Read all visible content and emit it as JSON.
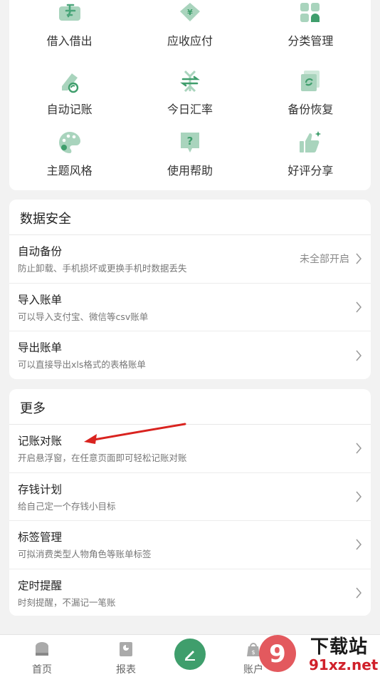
{
  "grid": {
    "items": [
      {
        "label": "借入借出",
        "icon": "lend-borrow-icon"
      },
      {
        "label": "应收应付",
        "icon": "receivable-payable-icon"
      },
      {
        "label": "分类管理",
        "icon": "category-manage-icon"
      },
      {
        "label": "自动记账",
        "icon": "auto-bookkeeping-icon"
      },
      {
        "label": "今日汇率",
        "icon": "exchange-rate-icon"
      },
      {
        "label": "备份恢复",
        "icon": "backup-restore-icon"
      },
      {
        "label": "主题风格",
        "icon": "palette-icon"
      },
      {
        "label": "使用帮助",
        "icon": "help-icon"
      },
      {
        "label": "好评分享",
        "icon": "thumbs-up-icon"
      }
    ]
  },
  "security": {
    "title": "数据安全",
    "rows": [
      {
        "title": "自动备份",
        "subtitle": "防止卸载、手机损坏或更换手机时数据丢失",
        "status": "未全部开启"
      },
      {
        "title": "导入账单",
        "subtitle": "可以导入支付宝、微信等csv账单"
      },
      {
        "title": "导出账单",
        "subtitle": "可以直接导出xls格式的表格账单"
      }
    ]
  },
  "more": {
    "title": "更多",
    "rows": [
      {
        "title": "记账对账",
        "subtitle": "开启悬浮窗，在任意页面即可轻松记账对账"
      },
      {
        "title": "存钱计划",
        "subtitle": "给自己定一个存钱小目标"
      },
      {
        "title": "标签管理",
        "subtitle": "可拟消费类型人物角色等账单标签"
      },
      {
        "title": "定时提醒",
        "subtitle": "时刻提醒，不漏记一笔账"
      }
    ]
  },
  "nav": {
    "home": "首页",
    "report": "报表",
    "account": "账户"
  },
  "watermark": {
    "text1": "下载站",
    "text2": "91xz.net"
  },
  "colors": {
    "accent": "#3f9e6c",
    "icon_light": "#a9d4bd",
    "icon_dark": "#5aae85",
    "annotation": "#d9231f"
  }
}
